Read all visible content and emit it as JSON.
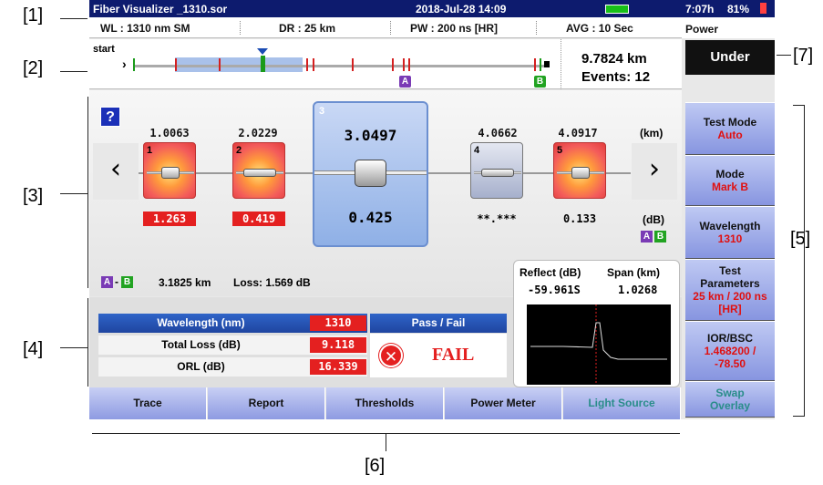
{
  "callouts": {
    "c1": "[1]",
    "c2": "[2]",
    "c3": "[3]",
    "c4": "[4]",
    "c5": "[5]",
    "c6": "[6]",
    "c7": "[7]"
  },
  "titlebar": {
    "filename": "Fiber Visualizer _1310.sor",
    "datetime": "2018-Jul-28 14:09",
    "battery_time": "7:07h",
    "battery_pct": "81%",
    "power_label": "Power"
  },
  "info": {
    "wl": "WL : 1310 nm SM",
    "dr": "DR : 25 km",
    "pw": "PW : 200 ns [HR]",
    "avg": "AVG : 10 Sec"
  },
  "overview": {
    "start_label": "start",
    "distance": "9.7824 km",
    "events": "Events: 12",
    "marker_a": "A",
    "marker_b": "B"
  },
  "status": {
    "under_label": "Under"
  },
  "events": [
    {
      "num": "1",
      "distance": "1.0063",
      "loss": "1.263",
      "loss_fail": true
    },
    {
      "num": "2",
      "distance": "2.0229",
      "loss": "0.419",
      "loss_fail": true
    },
    {
      "num": "3",
      "distance": "3.0497",
      "loss": "0.425",
      "loss_fail": false
    },
    {
      "num": "4",
      "distance": "4.0662",
      "loss": "**.***",
      "loss_fail": false
    },
    {
      "num": "5",
      "distance": "4.0917",
      "loss": "0.133",
      "loss_fail": false
    }
  ],
  "units": {
    "km": "(km)",
    "db": "(dB)"
  },
  "help_label": "?",
  "nav": {
    "prev": "‹",
    "next": "›"
  },
  "ab": {
    "a": "A",
    "b": "B",
    "dash": "-",
    "distance": "3.1825 km",
    "loss": "Loss: 1.569 dB"
  },
  "reflect": {
    "reflect_label": "Reflect (dB)",
    "span_label": "Span (km)",
    "reflect_value": "-59.961S",
    "span_value": "1.0268"
  },
  "results": {
    "rows": [
      {
        "label": "Wavelength (nm)",
        "value": "1310"
      },
      {
        "label": "Total Loss (dB)",
        "value": "9.118"
      },
      {
        "label": "ORL (dB)",
        "value": "16.339"
      }
    ],
    "passfail_label": "Pass / Fail",
    "verdict": "FAIL"
  },
  "menu": [
    {
      "label": "Test Mode",
      "value": "Auto"
    },
    {
      "label": "Mode",
      "value": "Mark B"
    },
    {
      "label": "Wavelength",
      "value": "1310"
    },
    {
      "label": "Test Parameters",
      "value": "25 km / 200 ns [HR]"
    },
    {
      "label": "IOR/BSC",
      "value": "1.468200 / -78.50"
    },
    {
      "label": "Swap Overlay",
      "value": ""
    }
  ],
  "tabs": [
    "Trace",
    "Report",
    "Thresholds",
    "Power Meter",
    "Light Source"
  ],
  "colors": {
    "fail": "#e42020",
    "accent": "#0d1b6e",
    "disabled_tab": "#2a8d8a"
  }
}
